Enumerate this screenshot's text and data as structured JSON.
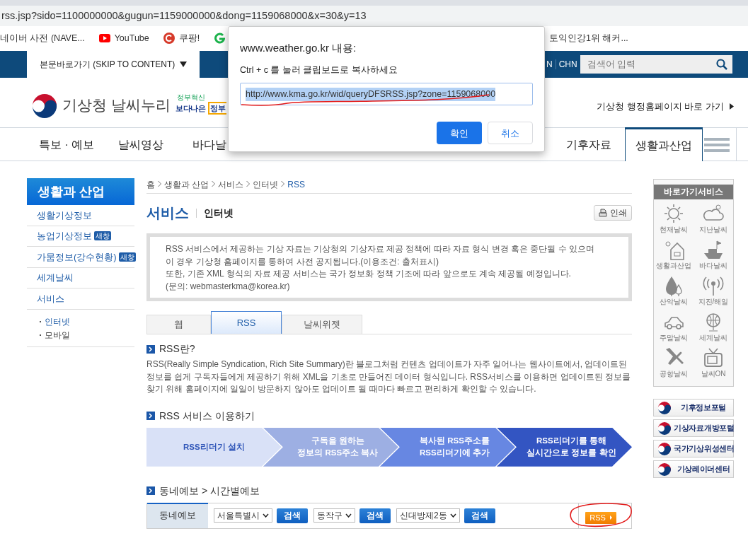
{
  "browser": {
    "url": "rss.jsp?sido=1100000000&gugun=1159000000&dong=1159068000&x=30&y=13",
    "bookmarks": [
      {
        "label": "네이버 사전 (NAVE..."
      },
      {
        "label": "YouTube",
        "kind": "video"
      },
      {
        "label": "쿠팡!",
        "kind": "circle"
      },
      {
        "kind": "ring"
      }
    ],
    "bookmarks_right": [
      {
        "label": "토익인강1위 해커..."
      }
    ]
  },
  "topbar": {
    "skip_link": "본문바로가기 (SKIP TO CONTENT)",
    "languages": [
      "N",
      "CHN"
    ],
    "search": {
      "placeholder": "검색어 입력"
    }
  },
  "header": {
    "logo_text": "기상청 날씨누리",
    "slogan_small": "정부혁신",
    "slogan_main": "보다나은",
    "slogan_bracket": "정부",
    "admin_link": "기상청 행정홈페이지 바로 가기"
  },
  "nav": {
    "left": [
      {
        "label": "특보 · 예보",
        "selected": false
      },
      {
        "label": "날씨영상",
        "selected": false
      },
      {
        "label": "바다날",
        "selected": false
      }
    ],
    "right": [
      {
        "label": "기후자료",
        "selected": false
      },
      {
        "label": "생활과산업",
        "selected": true
      }
    ]
  },
  "sidebar": {
    "title": "생활과 산업",
    "items": [
      {
        "label": "생활기상정보"
      },
      {
        "label": "농업기상정보",
        "badge": "새창"
      },
      {
        "label": "가뭄정보(강수현황)",
        "badge": "새창"
      },
      {
        "label": "세계날씨"
      },
      {
        "label": "서비스"
      }
    ],
    "subitems": [
      {
        "label": "인터넷",
        "selected": true
      },
      {
        "label": "모바일",
        "selected": false
      }
    ]
  },
  "breadcrumb": [
    "홈",
    "생활과 산업",
    "서비스",
    "인터넷",
    "RSS"
  ],
  "page_title": "서비스",
  "page_subtitle": "인터넷",
  "print_button": "인쇄",
  "notice": [
    "RSS 서비스에서 제공하는 기상 자료는 기상청의 기상자료 제공 정책에 따라 자료 형식 변경 혹은 중단될 수 있으며",
    "이 경우 기상청 홈페이지를 통하여 사전 공지됩니다.(이용조건: 출처표시)",
    "또한, 기존 XML 형식의 자료 제공 서비스는 국가 정보화 정책 기조에 따라 앞으로도 계속 제공될 예정입니다.",
    "(문의: webmasterkma@korea.kr)"
  ],
  "tabs": [
    {
      "label": "웹",
      "selected": false
    },
    {
      "label": "RSS",
      "selected": true
    },
    {
      "label": "날씨위젯",
      "selected": false
    }
  ],
  "about": {
    "heading": "RSS란?",
    "text": "RSS(Really Simple Syndication, Rich Site Summary)란 블로그처럼 컨텐츠 업데이트가 자주 일어나는 웹사이트에서, 업데이트된 정보를 쉽게 구독자들에게 제공하기 위해 XML을 기초로 만들어진 데이터 형식입니다. RSS서비스를 이용하면 업데이트된 정보를 찾기 위해 홈페이지에 일일이 방문하지 않아도 업데이트 될 때마다 빠르고 편리하게 확인할 수 있습니다."
  },
  "usage": {
    "heading": "RSS 서비스 이용하기",
    "steps": [
      {
        "lines": [
          "RSS리더기 설치"
        ],
        "color": "#d9e1f7"
      },
      {
        "lines": [
          "구독을 원하는",
          "정보의 RSS주소 복사"
        ],
        "color": "#9dafe3"
      },
      {
        "lines": [
          "복사된 RSS주소를",
          "RSS리더기에 추가"
        ],
        "color": "#6787e2"
      },
      {
        "lines": [
          "RSS리더기를 통해",
          "실시간으로 정보를 확인"
        ],
        "color": "#3355c2"
      }
    ]
  },
  "forecast": {
    "heading": "동네예보 > 시간별예보",
    "label": "동네예보",
    "selects": [
      {
        "value": "서울특별시",
        "button": "검색"
      },
      {
        "value": "동작구",
        "button": "검색"
      },
      {
        "value": "신대방제2동",
        "button": "검색"
      }
    ],
    "rss_button": "RSS"
  },
  "quick": {
    "title": "바로가기서비스",
    "items": [
      "현재날씨",
      "지난날씨",
      "생활과산업",
      "바다날씨",
      "산악날씨",
      "지진/해일",
      "주말날씨",
      "세계날씨",
      "공항날씨",
      "날씨ON"
    ]
  },
  "portals": [
    "기후정보포털",
    "기상자료개방포털",
    "국가기상위성센터",
    "기상레이더센터"
  ],
  "dialog": {
    "title": "www.weather.go.kr 내용:",
    "message": "Ctrl + c 를 눌러 클립보드로 복사하세요",
    "value": "http://www.kma.go.kr/wid/queryDFSRSS.jsp?zone=1159068000",
    "ok": "확인",
    "cancel": "취소"
  }
}
